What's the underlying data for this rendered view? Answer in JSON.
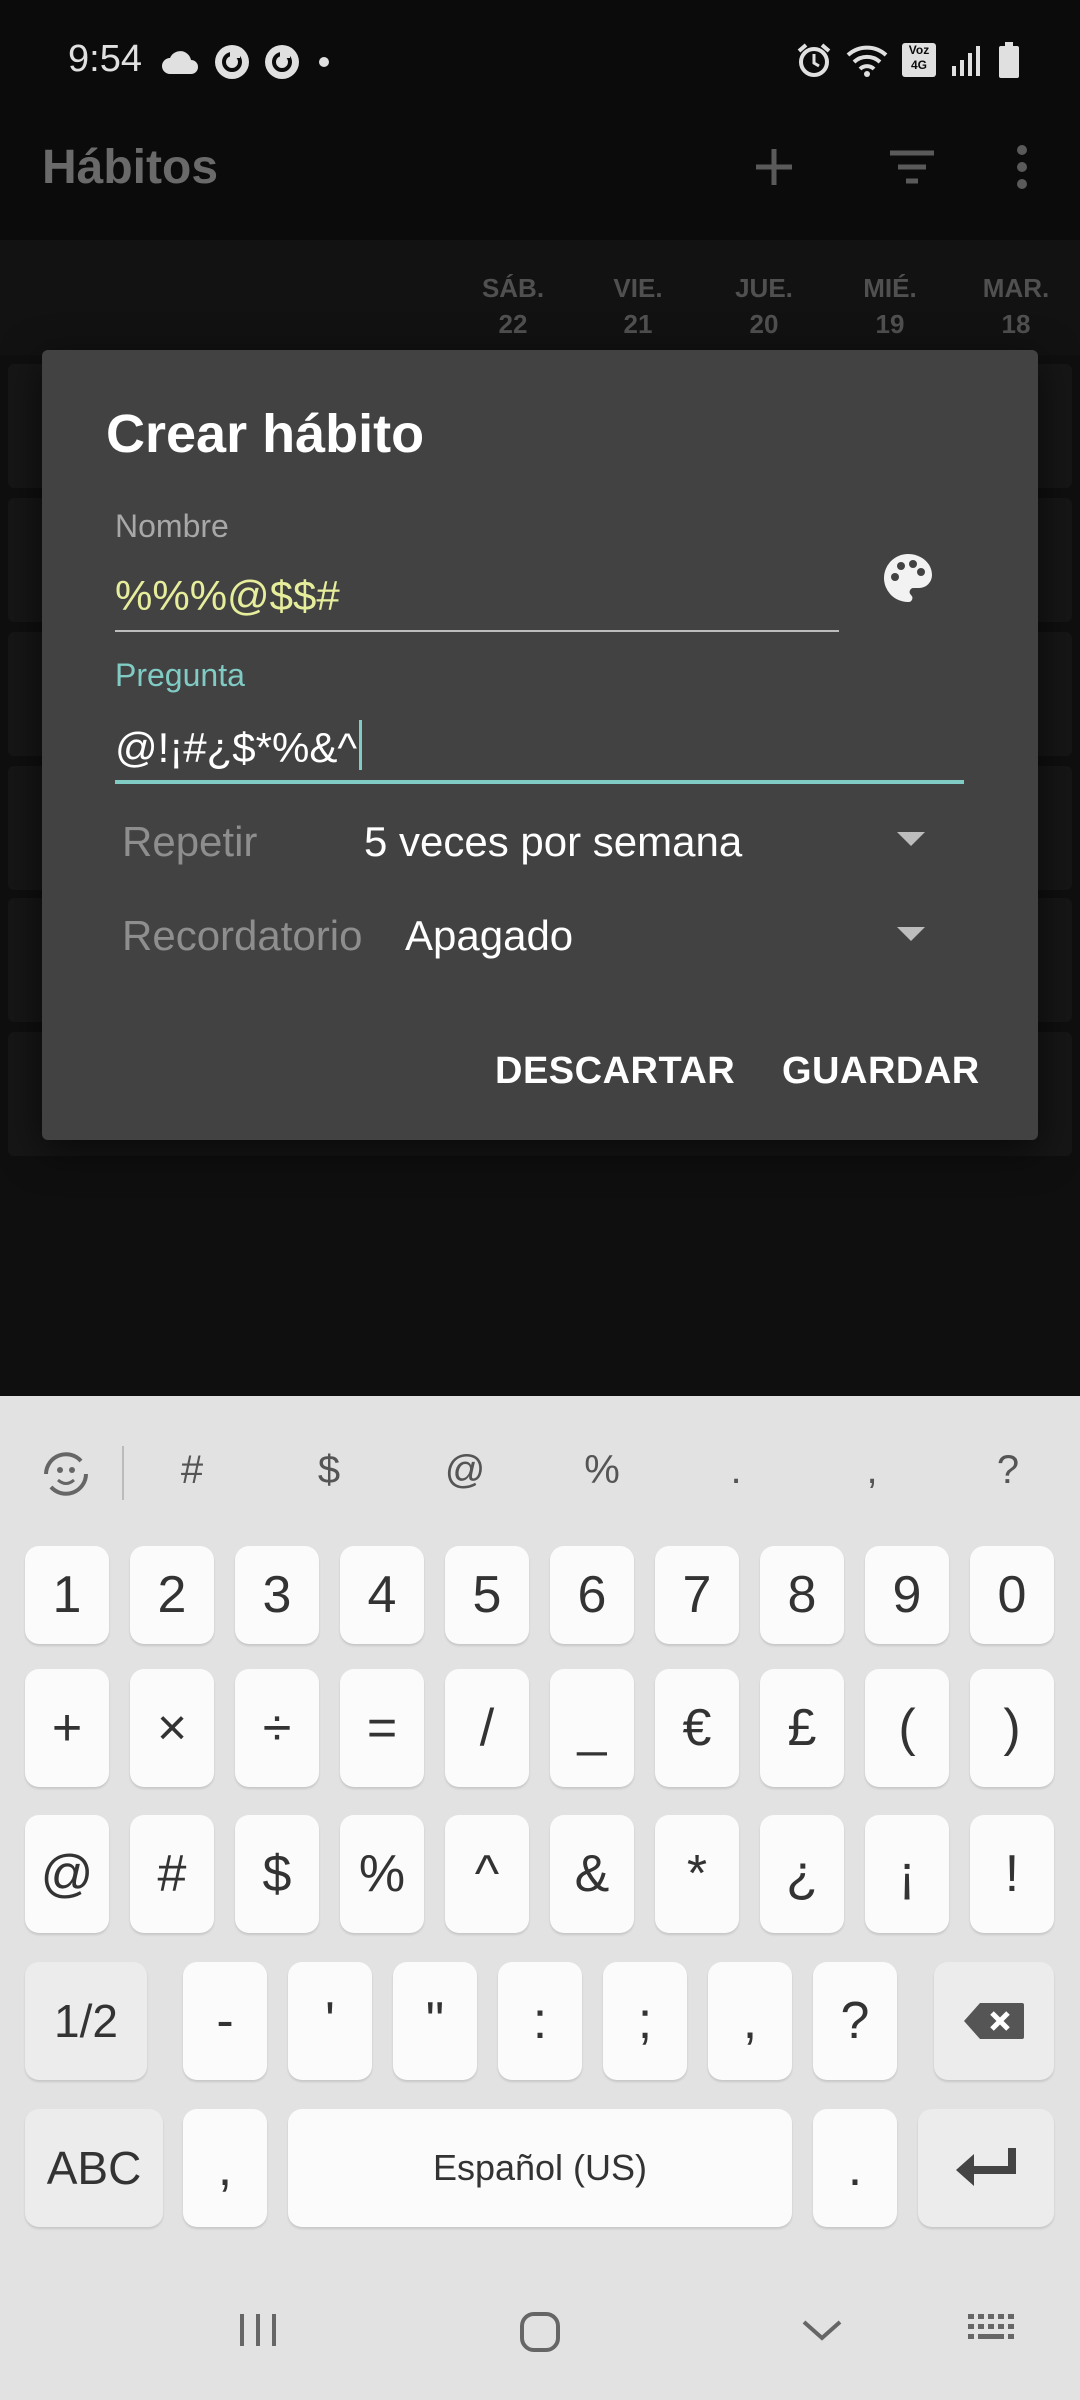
{
  "status_bar": {
    "time": "9:54",
    "left_icons": [
      "cloud-icon",
      "sync-icon",
      "sync-icon",
      "dot-icon"
    ],
    "right_icons": [
      "alarm-icon",
      "wifi-icon",
      "volte-icon",
      "signal-icon",
      "battery-icon"
    ],
    "volte_text": "Voz 4G"
  },
  "app_bar": {
    "title": "Hábitos",
    "actions": [
      "add-icon",
      "filter-icon",
      "more-vert-icon"
    ]
  },
  "days": [
    {
      "weekday": "SÁB.",
      "day": "22"
    },
    {
      "weekday": "VIE.",
      "day": "21"
    },
    {
      "weekday": "JUE.",
      "day": "20"
    },
    {
      "weekday": "MIÉ.",
      "day": "19"
    },
    {
      "weekday": "MAR.",
      "day": "18"
    }
  ],
  "dialog": {
    "title": "Crear hábito",
    "name_label": "Nombre",
    "name_value": "%%%@$$#",
    "question_label": "Pregunta",
    "question_value": "@!¡#¿$*%&^",
    "repeat_label": "Repetir",
    "repeat_value": "5 veces por semana",
    "reminder_label": "Recordatorio",
    "reminder_value": "Apagado",
    "discard_label": "DESCARTAR",
    "save_label": "GUARDAR",
    "colors": {
      "name_text": "#e6ee9c",
      "accent": "#80cbc4"
    }
  },
  "keyboard": {
    "suggestions": [
      "#",
      "$",
      "@",
      "%",
      ".",
      ",",
      "?"
    ],
    "row1": [
      "1",
      "2",
      "3",
      "4",
      "5",
      "6",
      "7",
      "8",
      "9",
      "0"
    ],
    "row2": [
      "+",
      "×",
      "÷",
      "=",
      "/",
      "_",
      "€",
      "£",
      "(",
      ")"
    ],
    "row3": [
      "@",
      "#",
      "$",
      "%",
      "^",
      "&",
      "*",
      "¿",
      "¡",
      "!"
    ],
    "row4": [
      "1/2",
      "-",
      "'",
      "\"",
      ":",
      ";",
      ",",
      "?"
    ],
    "row5": [
      "ABC",
      ",",
      "Español (US)",
      "."
    ]
  },
  "nav_bar": [
    "recents-icon",
    "home-icon",
    "back-icon",
    "keyboard-icon"
  ]
}
